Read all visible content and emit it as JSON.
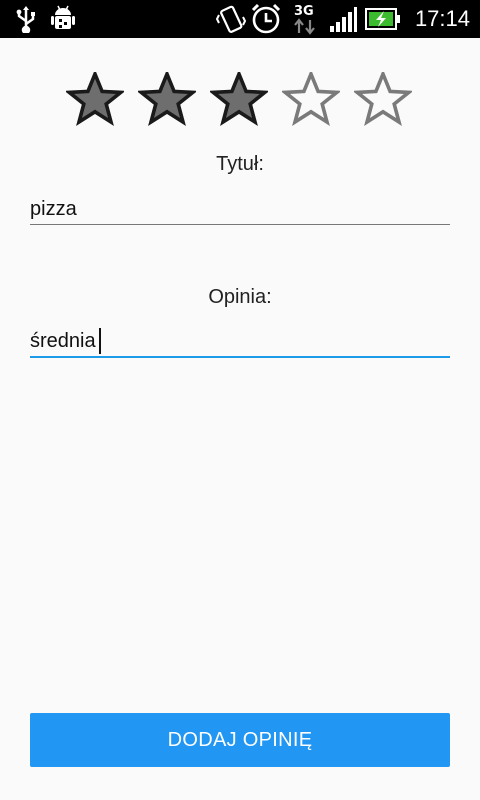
{
  "status_bar": {
    "network_label": "3G",
    "time": "17:14",
    "icons": [
      "usb-icon",
      "android-debug-icon",
      "vibrate-icon",
      "alarm-icon",
      "network-3g-icon",
      "signal-icon",
      "battery-charging-icon"
    ]
  },
  "rating": {
    "value": 3,
    "max": 5
  },
  "title_field": {
    "label": "Tytuł:",
    "value": "pizza"
  },
  "opinion_field": {
    "label": "Opinia:",
    "value": "średnia"
  },
  "submit_button": {
    "label": "DODAJ OPINIĘ"
  },
  "colors": {
    "accent": "#2196f3",
    "focus_underline": "#1e9be8",
    "star_filled": "#6e6e6e",
    "background": "#fafafa"
  }
}
